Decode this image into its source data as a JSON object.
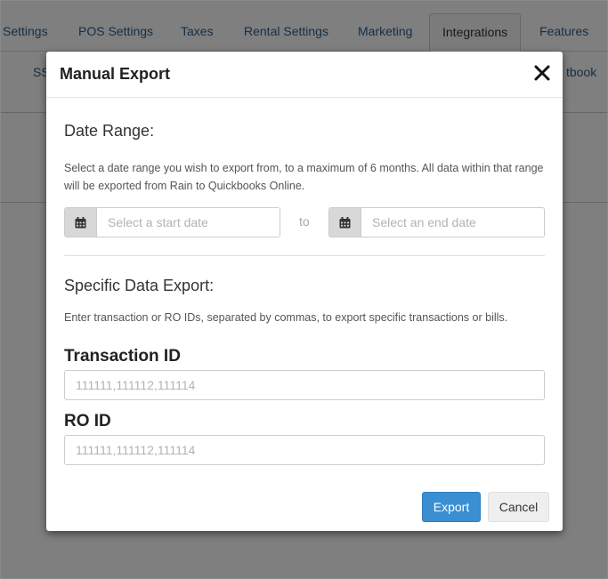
{
  "background": {
    "tabs": [
      "Settings",
      "POS Settings",
      "Taxes",
      "Rental Settings",
      "Marketing",
      "Integrations",
      "Features"
    ],
    "active_tab": "Integrations",
    "subnav_left": "SS",
    "subnav_right": "tbook"
  },
  "modal": {
    "title": "Manual Export",
    "date_range": {
      "heading": "Date Range:",
      "help": "Select a date range you wish to export from, to a maximum of 6 months. All data within that range will be exported from Rain to Quickbooks Online.",
      "start_placeholder": "Select a start date",
      "to_label": "to",
      "end_placeholder": "Select an end date",
      "icon": "calendar-icon"
    },
    "specific": {
      "heading": "Specific Data Export:",
      "help": "Enter transaction or RO IDs, separated by commas, to export specific transactions or bills.",
      "transaction_label": "Transaction ID",
      "transaction_placeholder": "111111,111112,111114",
      "transaction_value": "",
      "ro_label": "RO ID",
      "ro_placeholder": "111111,111112,111114",
      "ro_value": ""
    },
    "buttons": {
      "export_label": "Export",
      "cancel_label": "Cancel"
    },
    "colors": {
      "primary": "#3a8fd3",
      "link": "#2f5d8a",
      "overlay": "#000000"
    }
  }
}
